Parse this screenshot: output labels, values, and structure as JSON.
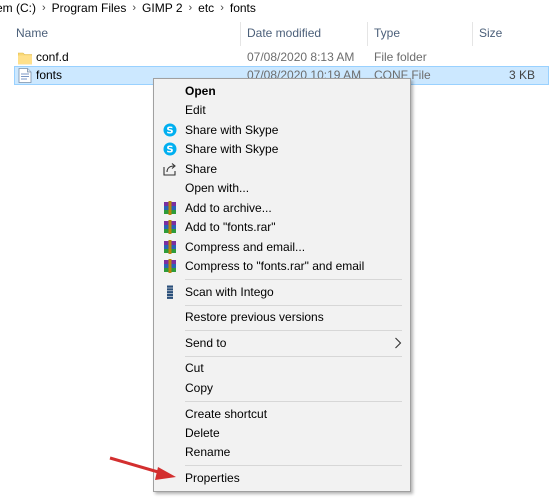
{
  "breadcrumb": {
    "items": [
      "em (C:)",
      "Program Files",
      "GIMP 2",
      "etc",
      "fonts"
    ]
  },
  "columns": {
    "name": "Name",
    "date": "Date modified",
    "type": "Type",
    "size": "Size"
  },
  "files": [
    {
      "name": "conf.d",
      "date": "07/08/2020 8:13 AM",
      "type": "File folder",
      "size": "",
      "icon": "folder-icon"
    },
    {
      "name": "fonts",
      "date": "07/08/2020 10:19 AM",
      "type": "CONF File",
      "size": "3 KB",
      "icon": "conf-file-icon"
    }
  ],
  "context_menu": {
    "open": "Open",
    "edit": "Edit",
    "share_skype_1": "Share with Skype",
    "share_skype_2": "Share with Skype",
    "share": "Share",
    "open_with": "Open with...",
    "add_archive": "Add to archive...",
    "add_rar": "Add to \"fonts.rar\"",
    "compress_email": "Compress and email...",
    "compress_rar_email": "Compress to \"fonts.rar\" and email",
    "scan_intego": "Scan with Intego",
    "restore_versions": "Restore previous versions",
    "send_to": "Send to",
    "cut": "Cut",
    "copy": "Copy",
    "create_shortcut": "Create shortcut",
    "delete": "Delete",
    "rename": "Rename",
    "properties": "Properties"
  },
  "colors": {
    "selection_bg": "#cce8ff",
    "selection_border": "#99d1ff",
    "menu_bg": "#f2f2f2",
    "annotation_arrow": "#d32f2f",
    "skype_blue": "#00aff0",
    "folder_yellow": "#f8d775"
  }
}
